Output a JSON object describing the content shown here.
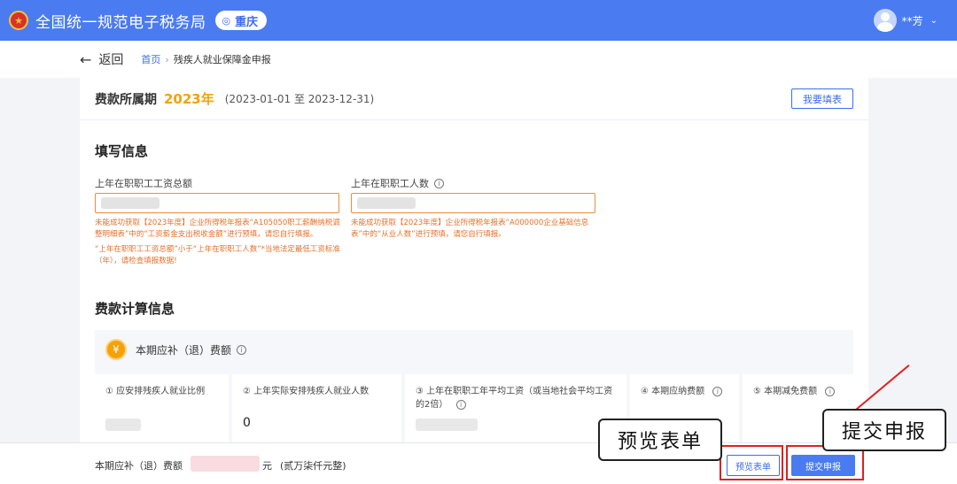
{
  "header": {
    "app_title": "全国统一规范电子税务局",
    "region": "重庆",
    "user_name": "**芳",
    "emblem_icon": "tax-emblem-icon"
  },
  "nav": {
    "back_label": "返回",
    "breadcrumb_home": "首页",
    "breadcrumb_sep": "›",
    "breadcrumb_current": "残疾人就业保障金申报"
  },
  "period": {
    "label": "费款所属期",
    "year": "2023年",
    "range": "(2023-01-01 至 2023-12-31)",
    "fill_button": "我要填表"
  },
  "fill_info": {
    "title": "填写信息",
    "salary_label": "上年在职职工工资总额",
    "headcount_label": "上年在职职工人数",
    "salary_warning": "未能成功获取【2023年度】企业所得税年报表“A105050职工薪酬纳税调整明细表”中的“工资薪金支出税收金额”进行预填，请您自行填报。",
    "salary_warning2": "“上年在职职工工资总额”小于“上年在职职工人数”*当地法定最低工资标准（年），请检查填报数据!",
    "headcount_warning": "未能成功获取【2023年度】企业所得税年报表“A000000企业基础信息表”中的“从业人数”进行预填，请您自行填报。"
  },
  "calc": {
    "title": "费款计算信息",
    "head_label": "本期应补（退）费额",
    "col1": "① 应安排残疾人就业比例",
    "col2": "② 上年实际安排残疾人就业人数",
    "col2_value": "0",
    "col3": "③ 上年在职职工年平均工资（或当地社会平均工资的2倍）",
    "col4": "④ 本期应纳费额",
    "col5": "⑤ 本期减免费额"
  },
  "footer": {
    "due_label": "本期应补（退）费额",
    "due_unit": "元",
    "due_words": "(贰万柒仟元整)",
    "preview_button": "预览表单",
    "submit_button": "提交申报"
  },
  "annotations": {
    "preview_callout": "预览表单",
    "submit_callout": "提交申报"
  },
  "colors": {
    "brand_blue": "#4a7bf0",
    "accent_orange": "#f5a10a",
    "warning_orange": "#e8702a",
    "annotation_red": "#e02020"
  }
}
